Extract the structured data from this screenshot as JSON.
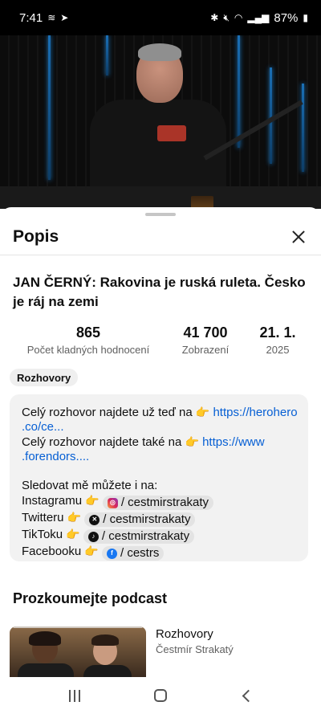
{
  "status_bar": {
    "time": "7:41",
    "battery": "87%",
    "left_icons": [
      "signal-wave-icon",
      "telegram-icon"
    ],
    "right_icons": [
      "bluetooth-icon",
      "mute-icon",
      "wifi-icon",
      "cell-signal-icon",
      "battery-icon"
    ]
  },
  "sheet": {
    "title": "Popis",
    "close_icon": "close-icon"
  },
  "video": {
    "title": "JAN ČERNÝ: Rakovina je ruská ruleta. Česko je ráj na zemi",
    "stats": {
      "likes": "865",
      "likes_label": "Počet kladných hodnocení",
      "views": "41 700",
      "views_label": "Zobrazení",
      "date_day": "21. 1.",
      "date_year": "2025"
    },
    "tag": "Rozhovory"
  },
  "description": {
    "line1_text": "Celý rozhovor najdete už teď na",
    "line1_link_a": "https://herohero",
    "line1_link_b": ".co/ce...",
    "line2_text": "Celý rozhovor najdete také na",
    "line2_link_a": "https://www",
    "line2_link_b": ".forendors....",
    "follow": "Sledovat mě můžete i na:",
    "pointing_emoji": "👉",
    "socials": [
      {
        "platform": "Instagramu",
        "handle": "/ cestmirstrakaty",
        "icon": "instagram-icon"
      },
      {
        "platform": "Twitteru",
        "handle": "/ cestmirstrakaty",
        "icon": "x-icon"
      },
      {
        "platform": "TikToku",
        "handle": "/ cestmirstrakaty",
        "icon": "tiktok-icon"
      },
      {
        "platform": "Facebooku",
        "handle": "/ cestrs",
        "icon": "facebook-icon"
      }
    ]
  },
  "explore": {
    "title": "Prozkoumejte podcast",
    "podcast_name": "Rozhovory",
    "podcast_author": "Čestmír Strakatý"
  },
  "nav_bar": {
    "icons": [
      "recents-icon",
      "home-icon",
      "back-icon"
    ]
  },
  "colors": {
    "link": "#065fd4",
    "box_bg": "#f2f2f2",
    "secondary_text": "#606060"
  }
}
